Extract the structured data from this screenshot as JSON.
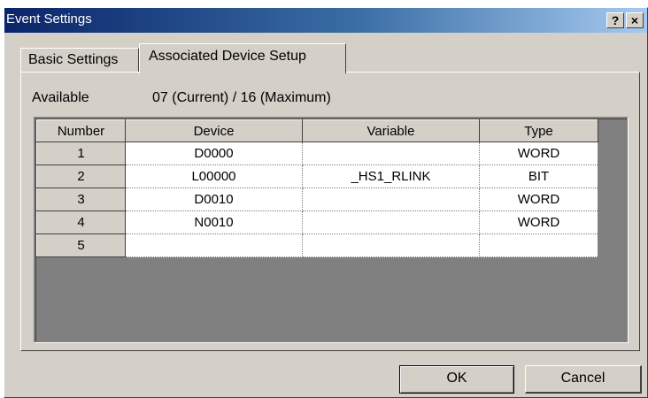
{
  "window": {
    "title": "Event Settings",
    "help_label": "?",
    "close_label": "×"
  },
  "tabs": [
    {
      "label": "Basic Settings",
      "active": false
    },
    {
      "label": "Associated Device Setup",
      "active": true
    }
  ],
  "available": {
    "label": "Available",
    "value": "07  (Current)  /  16 (Maximum)"
  },
  "table": {
    "headers": [
      "Number",
      "Device",
      "Variable",
      "Type"
    ],
    "rows": [
      {
        "number": "1",
        "device": "D0000",
        "variable": "",
        "type": "WORD"
      },
      {
        "number": "2",
        "device": "L00000",
        "variable": "_HS1_RLINK",
        "type": "BIT"
      },
      {
        "number": "3",
        "device": "D0010",
        "variable": "",
        "type": "WORD"
      },
      {
        "number": "4",
        "device": "N0010",
        "variable": "",
        "type": "WORD"
      },
      {
        "number": "5",
        "device": "",
        "variable": "",
        "type": ""
      }
    ]
  },
  "buttons": {
    "ok": "OK",
    "cancel": "Cancel"
  }
}
